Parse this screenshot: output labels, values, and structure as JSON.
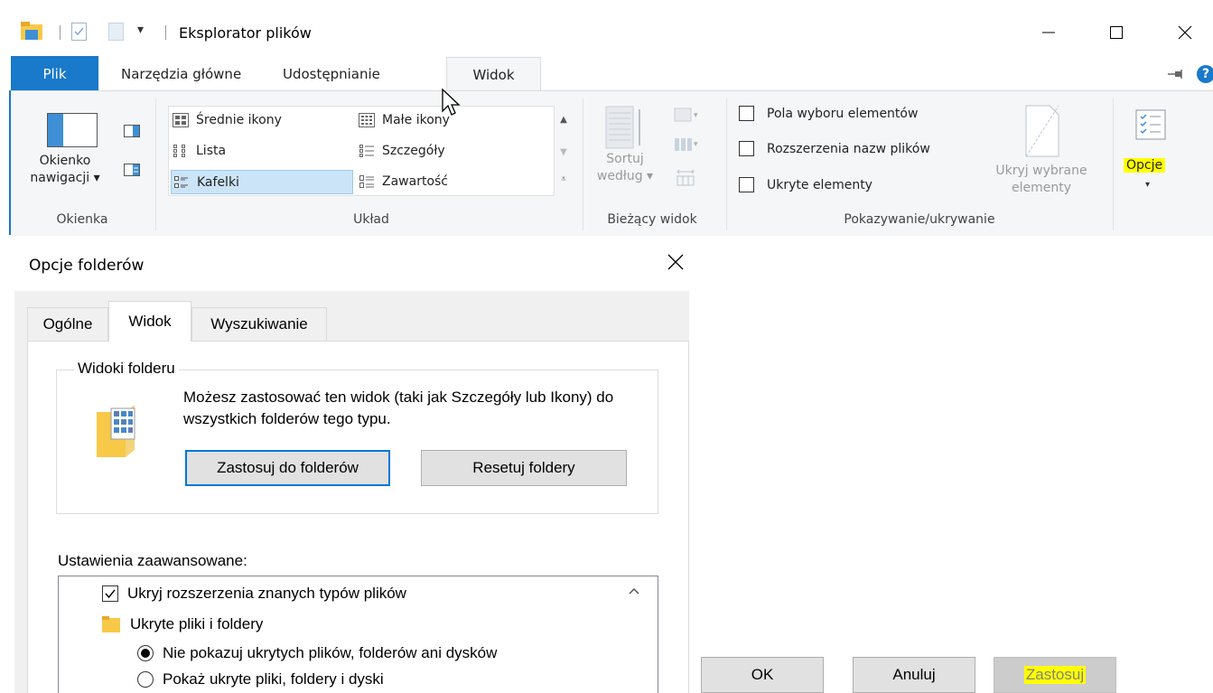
{
  "window": {
    "title": "Eksplorator plików",
    "qa_dropdown": "▾"
  },
  "ribbon_tabs": {
    "file": "Plik",
    "home": "Narzędzia główne",
    "share": "Udostępnianie",
    "view": "Widok"
  },
  "ribbon": {
    "panes": {
      "nav_pane_label_1": "Okienko",
      "nav_pane_label_2": "nawigacji ▾",
      "group": "Okienka"
    },
    "layout": {
      "items": [
        "Średnie ikony",
        "Małe ikony",
        "Lista",
        "Szczegóły",
        "Kafelki",
        "Zawartość"
      ],
      "selected": "Kafelki",
      "group": "Układ"
    },
    "current_view": {
      "sort_label_1": "Sortuj",
      "sort_label_2": "według ▾",
      "group": "Bieżący widok"
    },
    "show_hide": {
      "checkboxes": [
        {
          "label": "Pola wyboru elementów",
          "checked": false
        },
        {
          "label": "Rozszerzenia nazw plików",
          "checked": false
        },
        {
          "label": "Ukryte elementy",
          "checked": false
        }
      ],
      "hide_selected_1": "Ukryj wybrane",
      "hide_selected_2": "elementy",
      "group": "Pokazywanie/ukrywanie"
    },
    "options": {
      "label": "Opcje",
      "arrow": "▾"
    }
  },
  "dialog": {
    "title": "Opcje folderów",
    "tabs": [
      "Ogólne",
      "Widok",
      "Wyszukiwanie"
    ],
    "active_tab": "Widok",
    "folder_views": {
      "title": "Widoki folderu",
      "description": "Możesz zastosować ten widok (taki jak Szczegóły lub Ikony) do wszystkich folderów tego typu.",
      "apply_button": "Zastosuj do folderów",
      "reset_button": "Resetuj foldery"
    },
    "advanced": {
      "label": "Ustawienia zaawansowane:",
      "items": [
        {
          "type": "checkbox",
          "checked": true,
          "label": "Ukryj rozszerzenia znanych typów plików"
        },
        {
          "type": "folder",
          "label": "Ukryte pliki i foldery"
        },
        {
          "type": "radio",
          "checked": true,
          "label": "Nie pokazuj ukrytych plików, folderów ani dysków"
        },
        {
          "type": "radio",
          "checked": false,
          "label": "Pokaż ukryte pliki, foldery i dyski"
        }
      ]
    },
    "buttons": {
      "ok": "OK",
      "cancel": "Anuluj",
      "apply": "Zastosuj"
    }
  },
  "colors": {
    "accent": "#1979ca",
    "highlight": "#ffff00",
    "selected_bg": "#cce4f7"
  }
}
